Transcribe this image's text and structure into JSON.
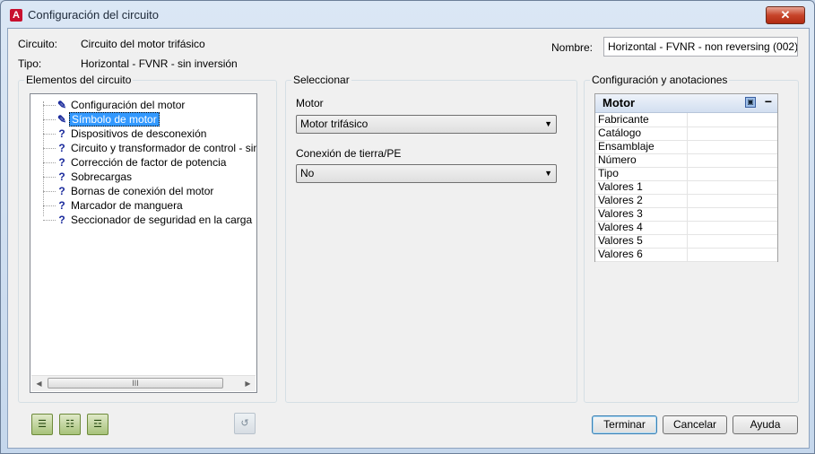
{
  "window": {
    "title": "Configuración del circuito",
    "close_label": "✕"
  },
  "info": {
    "circuito_label": "Circuito:",
    "circuito_value": "Circuito del motor trifásico",
    "tipo_label": "Tipo:",
    "tipo_value": "Horizontal - FVNR - sin inversión",
    "nombre_label": "Nombre:",
    "nombre_value": "Horizontal - FVNR - non reversing (002)"
  },
  "elements": {
    "title": "Elementos del circuito",
    "items": [
      {
        "icon": "pencil-icon",
        "glyph": "✎",
        "label": "Configuración del motor",
        "selected": false
      },
      {
        "icon": "pencil-icon",
        "glyph": "✎",
        "label": "Símbolo de motor",
        "selected": true
      },
      {
        "icon": "question-icon",
        "glyph": "?",
        "label": "Dispositivos de desconexión",
        "selected": false
      },
      {
        "icon": "question-icon",
        "glyph": "?",
        "label": "Circuito y transformador de control - sin inver",
        "selected": false
      },
      {
        "icon": "question-icon",
        "glyph": "?",
        "label": "Corrección de factor de potencia",
        "selected": false
      },
      {
        "icon": "question-icon",
        "glyph": "?",
        "label": "Sobrecargas",
        "selected": false
      },
      {
        "icon": "question-icon",
        "glyph": "?",
        "label": "Bornas de conexión del motor",
        "selected": false
      },
      {
        "icon": "question-icon",
        "glyph": "?",
        "label": "Marcador de manguera",
        "selected": false
      },
      {
        "icon": "question-icon",
        "glyph": "?",
        "label": "Seccionador de seguridad en la carga",
        "selected": false
      }
    ],
    "scroll_left": "◀",
    "scroll_right": "▶",
    "scroll_grip": "III"
  },
  "select": {
    "title": "Seleccionar",
    "motor_label": "Motor",
    "motor_value": "Motor trifásico",
    "tierra_label": "Conexión de tierra/PE",
    "tierra_value": "No",
    "dropdown_glyph": "▼"
  },
  "config": {
    "title": "Configuración y anotaciones",
    "panel_title": "Motor",
    "collapse_glyph": "−",
    "rows": [
      "Fabricante",
      "Catálogo",
      "Ensamblaje",
      "Número",
      "Tipo",
      "Valores 1",
      "Valores 2",
      "Valores 3",
      "Valores 4",
      "Valores 5",
      "Valores 6"
    ]
  },
  "buttons": {
    "terminar": "Terminar",
    "cancelar": "Cancelar",
    "ayuda": "Ayuda"
  },
  "colors": {
    "selection": "#3399ff",
    "default_border": "#3c7fb1",
    "close": "#c7442a"
  }
}
